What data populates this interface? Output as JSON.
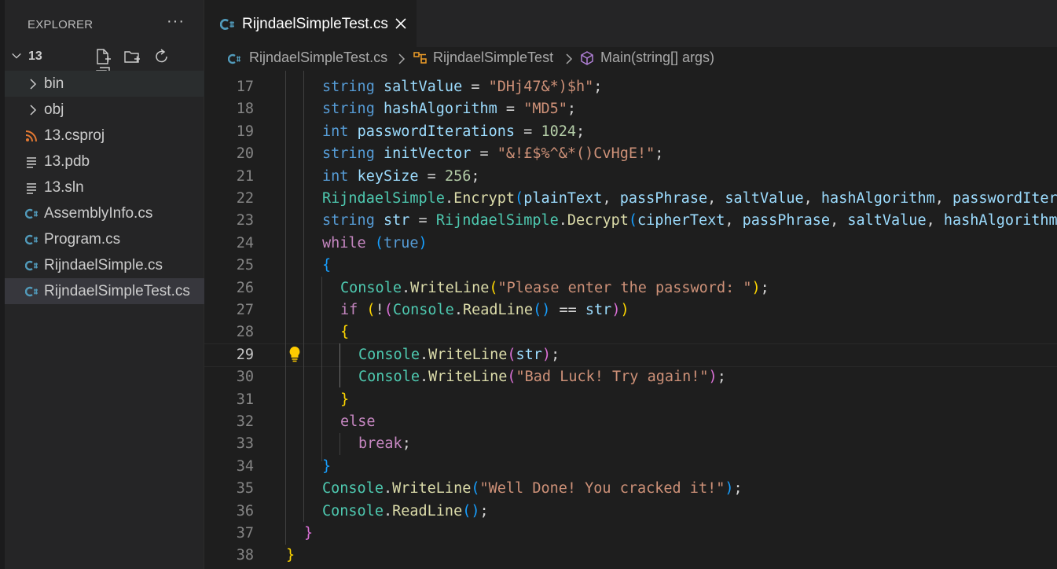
{
  "explorer": {
    "title": "EXPLORER",
    "more_glyph": "···",
    "folder": "13",
    "items": [
      {
        "label": "bin",
        "icon": "chevron-right-icon"
      },
      {
        "label": "obj",
        "icon": "chevron-right-icon"
      },
      {
        "label": "13.csproj",
        "icon": "rss-icon"
      },
      {
        "label": "13.pdb",
        "icon": "lines-icon"
      },
      {
        "label": "13.sln",
        "icon": "lines-icon"
      },
      {
        "label": "AssemblyInfo.cs",
        "icon": "csharp-icon"
      },
      {
        "label": "Program.cs",
        "icon": "csharp-icon"
      },
      {
        "label": "RijndaelSimple.cs",
        "icon": "csharp-icon"
      },
      {
        "label": "RijndaelSimpleTest.cs",
        "icon": "csharp-icon"
      }
    ]
  },
  "tab": {
    "label": "RijndaelSimpleTest.cs"
  },
  "breadcrumb": {
    "file": "RijndaelSimpleTest.cs",
    "class": "RijndaelSimpleTest",
    "method": "Main(string[] args)"
  },
  "code": {
    "current_line": 29,
    "lines": [
      {
        "num": "17",
        "indent": 2,
        "tokens": [
          [
            "k",
            "string "
          ],
          [
            "v",
            "saltValue"
          ],
          [
            "p",
            " = "
          ],
          [
            "s",
            "\"DHj47&*)$h\""
          ],
          [
            "p",
            ";"
          ]
        ]
      },
      {
        "num": "18",
        "indent": 2,
        "tokens": [
          [
            "k",
            "string "
          ],
          [
            "v",
            "hashAlgorithm"
          ],
          [
            "p",
            " = "
          ],
          [
            "s",
            "\"MD5\""
          ],
          [
            "p",
            ";"
          ]
        ]
      },
      {
        "num": "19",
        "indent": 2,
        "tokens": [
          [
            "k",
            "int "
          ],
          [
            "v",
            "passwordIterations"
          ],
          [
            "p",
            " = "
          ],
          [
            "n",
            "1024"
          ],
          [
            "p",
            ";"
          ]
        ]
      },
      {
        "num": "20",
        "indent": 2,
        "tokens": [
          [
            "k",
            "string "
          ],
          [
            "v",
            "initVector"
          ],
          [
            "p",
            " = "
          ],
          [
            "s",
            "\"&!£$%^&*()CvHgE!\""
          ],
          [
            "p",
            ";"
          ]
        ]
      },
      {
        "num": "21",
        "indent": 2,
        "tokens": [
          [
            "k",
            "int "
          ],
          [
            "v",
            "keySize"
          ],
          [
            "p",
            " = "
          ],
          [
            "n",
            "256"
          ],
          [
            "p",
            ";"
          ]
        ]
      },
      {
        "num": "22",
        "indent": 2,
        "tokens": [
          [
            "t",
            "RijndaelSimple"
          ],
          [
            "p",
            "."
          ],
          [
            "f",
            "Encrypt"
          ],
          [
            "b3",
            "("
          ],
          [
            "v",
            "plainText"
          ],
          [
            "p",
            ", "
          ],
          [
            "v",
            "passPhrase"
          ],
          [
            "p",
            ", "
          ],
          [
            "v",
            "saltValue"
          ],
          [
            "p",
            ", "
          ],
          [
            "v",
            "hashAlgorithm"
          ],
          [
            "p",
            ", "
          ],
          [
            "v",
            "passwordIterations"
          ]
        ]
      },
      {
        "num": "23",
        "indent": 2,
        "tokens": [
          [
            "k",
            "string "
          ],
          [
            "v",
            "str"
          ],
          [
            "p",
            " = "
          ],
          [
            "t",
            "RijndaelSimple"
          ],
          [
            "p",
            "."
          ],
          [
            "f",
            "Decrypt"
          ],
          [
            "b3",
            "("
          ],
          [
            "v",
            "cipherText"
          ],
          [
            "p",
            ", "
          ],
          [
            "v",
            "passPhrase"
          ],
          [
            "p",
            ", "
          ],
          [
            "v",
            "saltValue"
          ],
          [
            "p",
            ", "
          ],
          [
            "v",
            "hashAlgorithm"
          ]
        ]
      },
      {
        "num": "24",
        "indent": 2,
        "tokens": [
          [
            "c",
            "while "
          ],
          [
            "b3",
            "("
          ],
          [
            "k",
            "true"
          ],
          [
            "b3",
            ")"
          ]
        ]
      },
      {
        "num": "25",
        "indent": 2,
        "tokens": [
          [
            "b3",
            "{"
          ]
        ]
      },
      {
        "num": "26",
        "indent": 3,
        "tokens": [
          [
            "t",
            "Console"
          ],
          [
            "p",
            "."
          ],
          [
            "f",
            "WriteLine"
          ],
          [
            "b1",
            "("
          ],
          [
            "s",
            "\"Please enter the password: \""
          ],
          [
            "b1",
            ")"
          ],
          [
            "p",
            ";"
          ]
        ]
      },
      {
        "num": "27",
        "indent": 3,
        "tokens": [
          [
            "c",
            "if "
          ],
          [
            "b1",
            "("
          ],
          [
            "p",
            "!"
          ],
          [
            "b2",
            "("
          ],
          [
            "t",
            "Console"
          ],
          [
            "p",
            "."
          ],
          [
            "f",
            "ReadLine"
          ],
          [
            "b3",
            "()"
          ],
          [
            "p",
            " == "
          ],
          [
            "v",
            "str"
          ],
          [
            "b2",
            ")"
          ],
          [
            "b1",
            ")"
          ]
        ]
      },
      {
        "num": "28",
        "indent": 3,
        "tokens": [
          [
            "b1",
            "{"
          ]
        ]
      },
      {
        "num": "29",
        "indent": 4,
        "tokens": [
          [
            "t",
            "Console"
          ],
          [
            "p",
            "."
          ],
          [
            "f",
            "WriteLine"
          ],
          [
            "b2",
            "("
          ],
          [
            "v",
            "str"
          ],
          [
            "b2",
            ")"
          ],
          [
            "p",
            ";"
          ]
        ]
      },
      {
        "num": "30",
        "indent": 4,
        "tokens": [
          [
            "t",
            "Console"
          ],
          [
            "p",
            "."
          ],
          [
            "f",
            "WriteLine"
          ],
          [
            "b2",
            "("
          ],
          [
            "s",
            "\"Bad Luck! Try again!\""
          ],
          [
            "b2",
            ")"
          ],
          [
            "p",
            ";"
          ]
        ]
      },
      {
        "num": "31",
        "indent": 3,
        "tokens": [
          [
            "b1",
            "}"
          ]
        ]
      },
      {
        "num": "32",
        "indent": 3,
        "tokens": [
          [
            "c",
            "else"
          ]
        ]
      },
      {
        "num": "33",
        "indent": 4,
        "tokens": [
          [
            "c",
            "break"
          ],
          [
            "p",
            ";"
          ]
        ]
      },
      {
        "num": "34",
        "indent": 2,
        "tokens": [
          [
            "b3",
            "}"
          ]
        ]
      },
      {
        "num": "35",
        "indent": 2,
        "tokens": [
          [
            "t",
            "Console"
          ],
          [
            "p",
            "."
          ],
          [
            "f",
            "WriteLine"
          ],
          [
            "b3",
            "("
          ],
          [
            "s",
            "\"Well Done! You cracked it!\""
          ],
          [
            "b3",
            ")"
          ],
          [
            "p",
            ";"
          ]
        ]
      },
      {
        "num": "36",
        "indent": 2,
        "tokens": [
          [
            "t",
            "Console"
          ],
          [
            "p",
            "."
          ],
          [
            "f",
            "ReadLine"
          ],
          [
            "b3",
            "()"
          ],
          [
            "p",
            ";"
          ]
        ]
      },
      {
        "num": "37",
        "indent": 1,
        "tokens": [
          [
            "b2",
            "}"
          ]
        ]
      },
      {
        "num": "38",
        "indent": 0,
        "tokens": [
          [
            "b1",
            "}"
          ]
        ]
      }
    ]
  }
}
